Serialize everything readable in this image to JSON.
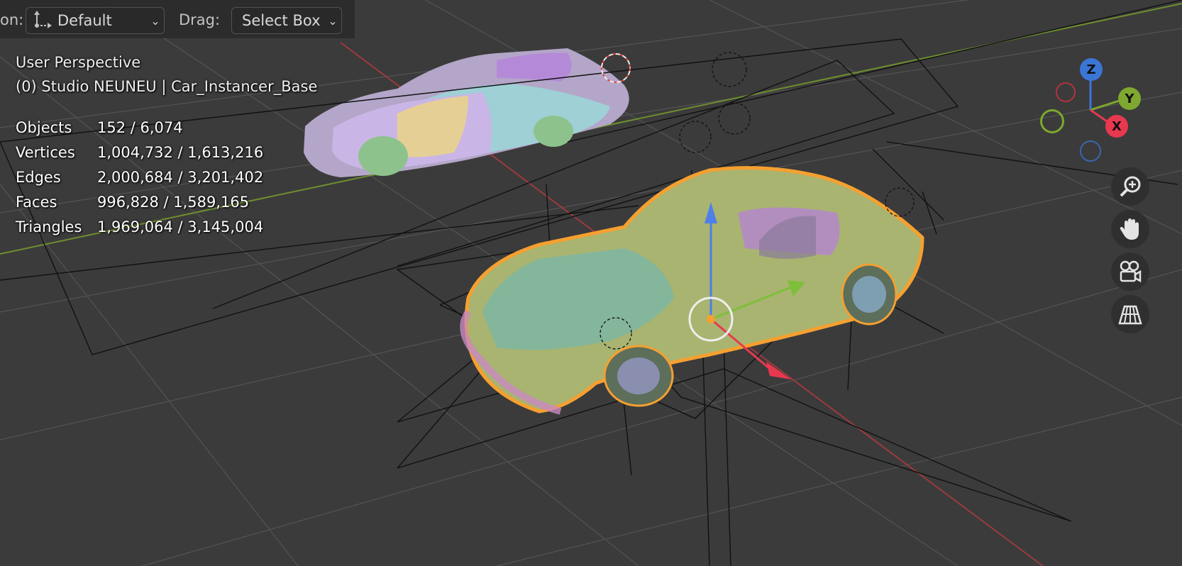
{
  "header": {
    "orientation_label": "on:",
    "orientation_value": "Default",
    "drag_label": "Drag:",
    "drag_value": "Select Box"
  },
  "viewport": {
    "view_name": "User Perspective",
    "scene_info": "(0) Studio NEUNEU | Car_Instancer_Base",
    "stats": [
      {
        "label": "Objects",
        "value": "152 / 6,074"
      },
      {
        "label": "Vertices",
        "value": "1,004,732 / 1,613,216"
      },
      {
        "label": "Edges",
        "value": "2,000,684 / 3,201,402"
      },
      {
        "label": "Faces",
        "value": "996,828 / 1,589,165"
      },
      {
        "label": "Triangles",
        "value": "1,969,064 / 3,145,004"
      }
    ]
  },
  "gizmo": {
    "z_label": "Z",
    "y_label": "Y",
    "x_label": "X",
    "colors": {
      "x": "#e8384f",
      "y": "#7ea82f",
      "z": "#3b76d6"
    }
  },
  "nav_icons": [
    "zoom-icon",
    "hand-pan-icon",
    "camera-icon",
    "perspective-grid-icon"
  ],
  "colors": {
    "background": "#3b3b3b",
    "selection_outline": "#f5a030",
    "grid_line": "#545454"
  }
}
